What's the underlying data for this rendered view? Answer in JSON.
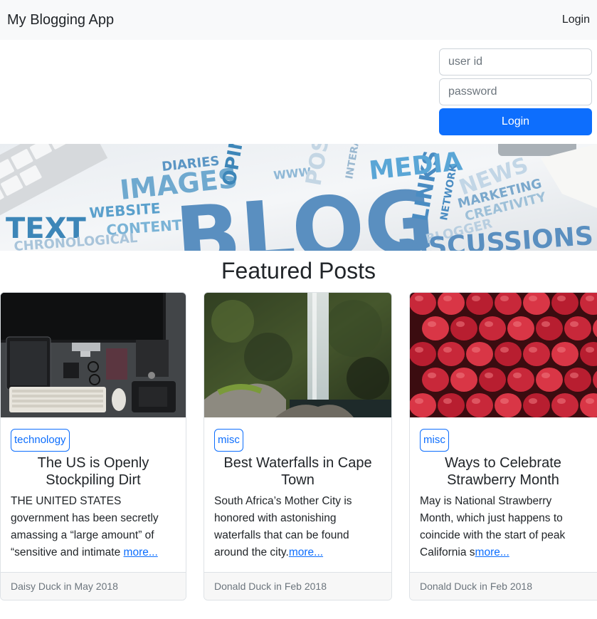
{
  "navbar": {
    "brand": "My Blogging App",
    "login_link": "Login"
  },
  "login_form": {
    "user_placeholder": "user id",
    "password_placeholder": "password",
    "submit_label": "Login"
  },
  "hero": {
    "words": [
      "TEXT",
      "WEBSITE",
      "CONTENT",
      "IMAGES",
      "DIARIES",
      "OPINION",
      "WWW",
      "BLOG",
      "LINKS",
      "MEDIA",
      "NETWORK",
      "NEWS",
      "MARKETING",
      "CREATIVITY",
      "CHRONOLOGICAL",
      "BLOGGER",
      "DISCUSSIONS",
      "POST",
      "INTERACT"
    ]
  },
  "featured": {
    "title": "Featured Posts",
    "posts": [
      {
        "category": "technology",
        "title": "The US is Openly Stockpiling Dirt",
        "excerpt": "THE UNITED STATES government has been secretly amassing a “large amount” of “sensitive and intimate ",
        "more": "more...",
        "footer": "Daisy Duck in May 2018"
      },
      {
        "category": "misc",
        "title": "Best Waterfalls in Cape Town",
        "excerpt": "South Africa’s Mother City is honored with astonishing waterfalls that can be found around the city.",
        "more": "more...",
        "footer": "Donald Duck in Feb 2018"
      },
      {
        "category": "misc",
        "title": "Ways to Celebrate Strawberry Month",
        "excerpt": "May is National Strawberry Month, which just happens to coincide with the start of peak California s",
        "more": "more...",
        "footer": "Donald Duck in Feb 2018"
      }
    ]
  },
  "colors": {
    "primary": "#0d6efd",
    "navbar_bg": "#f8f9fa",
    "footer_bg": "#f7f7f7"
  }
}
